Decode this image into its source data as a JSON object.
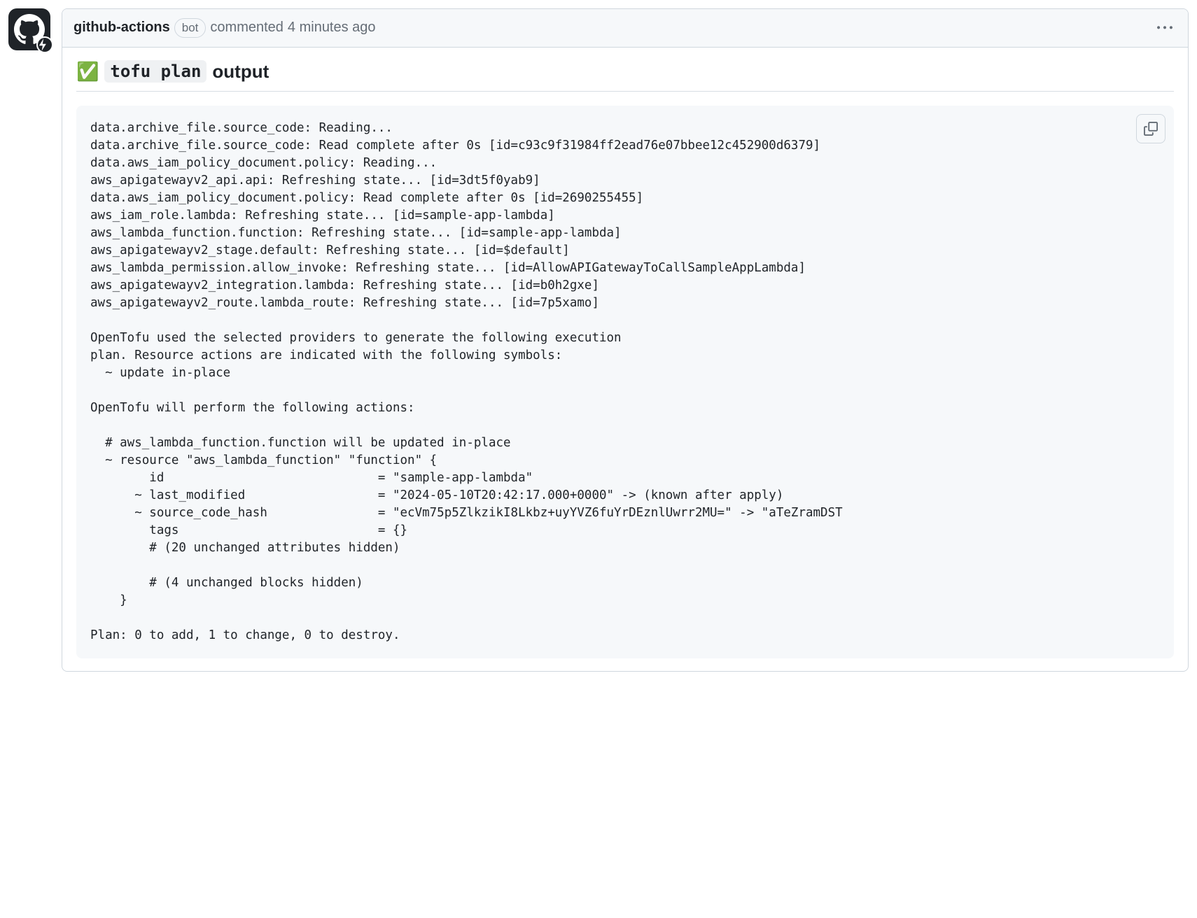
{
  "comment": {
    "author": "github-actions",
    "badge": "bot",
    "action_text": "commented",
    "timestamp": "4 minutes ago"
  },
  "heading": {
    "checkmark": "✅",
    "code": "tofu plan",
    "suffix": "output"
  },
  "code_output": "data.archive_file.source_code: Reading...\ndata.archive_file.source_code: Read complete after 0s [id=c93c9f31984ff2ead76e07bbee12c452900d6379]\ndata.aws_iam_policy_document.policy: Reading...\naws_apigatewayv2_api.api: Refreshing state... [id=3dt5f0yab9]\ndata.aws_iam_policy_document.policy: Read complete after 0s [id=2690255455]\naws_iam_role.lambda: Refreshing state... [id=sample-app-lambda]\naws_lambda_function.function: Refreshing state... [id=sample-app-lambda]\naws_apigatewayv2_stage.default: Refreshing state... [id=$default]\naws_lambda_permission.allow_invoke: Refreshing state... [id=AllowAPIGatewayToCallSampleAppLambda]\naws_apigatewayv2_integration.lambda: Refreshing state... [id=b0h2gxe]\naws_apigatewayv2_route.lambda_route: Refreshing state... [id=7p5xamo]\n\nOpenTofu used the selected providers to generate the following execution\nplan. Resource actions are indicated with the following symbols:\n  ~ update in-place\n\nOpenTofu will perform the following actions:\n\n  # aws_lambda_function.function will be updated in-place\n  ~ resource \"aws_lambda_function\" \"function\" {\n        id                             = \"sample-app-lambda\"\n      ~ last_modified                  = \"2024-05-10T20:42:17.000+0000\" -> (known after apply)\n      ~ source_code_hash               = \"ecVm75p5ZlkzikI8Lkbz+uyYVZ6fuYrDEznlUwrr2MU=\" -> \"aTeZramDST\n        tags                           = {}\n        # (20 unchanged attributes hidden)\n\n        # (4 unchanged blocks hidden)\n    }\n\nPlan: 0 to add, 1 to change, 0 to destroy."
}
